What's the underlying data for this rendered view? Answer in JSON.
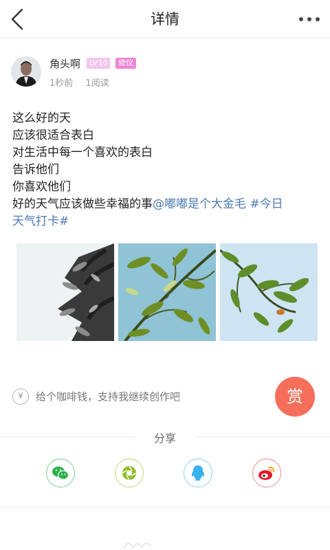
{
  "header": {
    "title": "详情",
    "back_icon": "chevron-left-icon",
    "more_icon": "more-dots-icon"
  },
  "author": {
    "name": "角头啊",
    "level": "LV10",
    "tag": "修仪",
    "time": "1秒前",
    "reads": "1阅读"
  },
  "post": {
    "lines": [
      "这么好的天",
      "应该很适合表白",
      "对生活中每一个喜欢的表白",
      "告诉他们",
      "你喜欢他们"
    ],
    "last_line_text": "好的天气应该做些幸福的事",
    "mention": "@嘟嘟是个大金毛",
    "topic_part1": " #今日",
    "topic_part2": "天气打卡#"
  },
  "donate": {
    "icon": "¥",
    "text": "给个咖啡钱，支持我继续创作吧",
    "reward_label": "赏"
  },
  "share": {
    "title": "分享",
    "items": [
      {
        "name": "wechat",
        "icon": "wechat-icon",
        "color": "#2bb24c"
      },
      {
        "name": "moments",
        "icon": "moments-icon",
        "color": "#8cbf26"
      },
      {
        "name": "qq",
        "icon": "qq-icon",
        "color": "#39b3f0"
      },
      {
        "name": "weibo",
        "icon": "weibo-icon",
        "color": "#e6162d"
      }
    ]
  },
  "colors": {
    "topic": "#4d7bb0",
    "reward": "#f56f5a",
    "level_badge": "#f2c6ee",
    "tag_badge": "#ee86d6"
  }
}
